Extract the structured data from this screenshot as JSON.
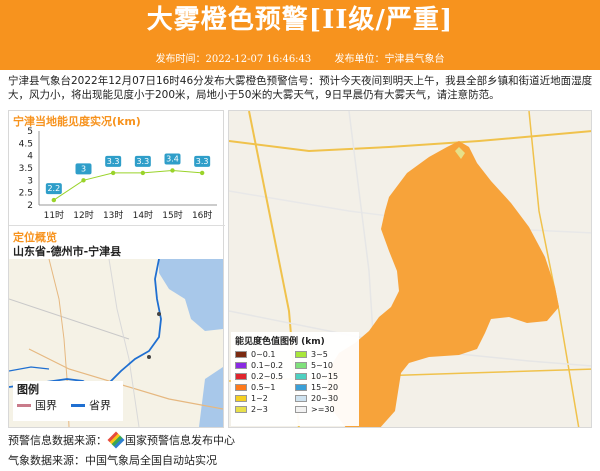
{
  "header": {
    "title": "大雾橙色预警[II级/严重]"
  },
  "meta": {
    "time_label": "发布时间：2022-12-07 16:46:43",
    "unit_label": "发布单位：宁津县气象台"
  },
  "description": "宁津县气象台2022年12月07日16时46分发布大雾橙色预警信号：预计今天夜间到明天上午，我县全部乡镇和街道近地面湿度大，风力小，将出现能见度小于200米，局地小于50米的大雾天气，9日早晨仍有大雾天气，请注意防范。",
  "visibility": {
    "title": "宁津当地能见度实况(km)",
    "y_ticks": [
      "5",
      "4.5",
      "4",
      "3.5",
      "3",
      "2.5",
      "2"
    ]
  },
  "chart_data": {
    "type": "line",
    "title": "宁津当地能见度实况(km)",
    "categories": [
      "11时",
      "12时",
      "13时",
      "14时",
      "15时",
      "16时"
    ],
    "values": [
      2.2,
      3,
      3.3,
      3.3,
      3.4,
      3.3
    ],
    "value_labels": [
      "2.2",
      "3",
      "3.3",
      "3.3",
      "3.4",
      "3.3"
    ],
    "ylim": [
      2,
      5
    ],
    "xlabel": "",
    "ylabel": ""
  },
  "location": {
    "title": "定位概览",
    "subtitle": "山东省-德州市-宁津县"
  },
  "legend_left": {
    "title": "图例",
    "items": [
      {
        "label": "国界",
        "color": "#c97b8a"
      },
      {
        "label": "省界",
        "color": "#1f6fd1"
      }
    ]
  },
  "legend_right": {
    "title": "能见度色值图例 (km)",
    "items": [
      {
        "label": "0~0.1",
        "color": "#7a2a10"
      },
      {
        "label": "3~5",
        "color": "#a8e63a"
      },
      {
        "label": "0.1~0.2",
        "color": "#8a2be2"
      },
      {
        "label": "5~10",
        "color": "#7fe07a"
      },
      {
        "label": "0.2~0.5",
        "color": "#e0242c"
      },
      {
        "label": "10~15",
        "color": "#4dd0c0"
      },
      {
        "label": "0.5~1",
        "color": "#ff7a1a"
      },
      {
        "label": "15~20",
        "color": "#3aa0d8"
      },
      {
        "label": "1~2",
        "color": "#f5d020"
      },
      {
        "label": "20~30",
        "color": "#cfe3f0"
      },
      {
        "label": "2~3",
        "color": "#e8e04a"
      },
      {
        "label": ">=30",
        "color": "#f2f2f2"
      }
    ]
  },
  "footer": {
    "source1_label": "预警信息数据来源：",
    "source1_value": "国家预警信息发布中心",
    "source2_label": "气象数据来源：",
    "source2_value": "中国气象局全国自动站实况"
  },
  "colors": {
    "accent": "#f7931e",
    "fog_area": "#f7a33a",
    "chart_label_bg": "#2f9ec9",
    "chart_point": "#9ad32a"
  }
}
